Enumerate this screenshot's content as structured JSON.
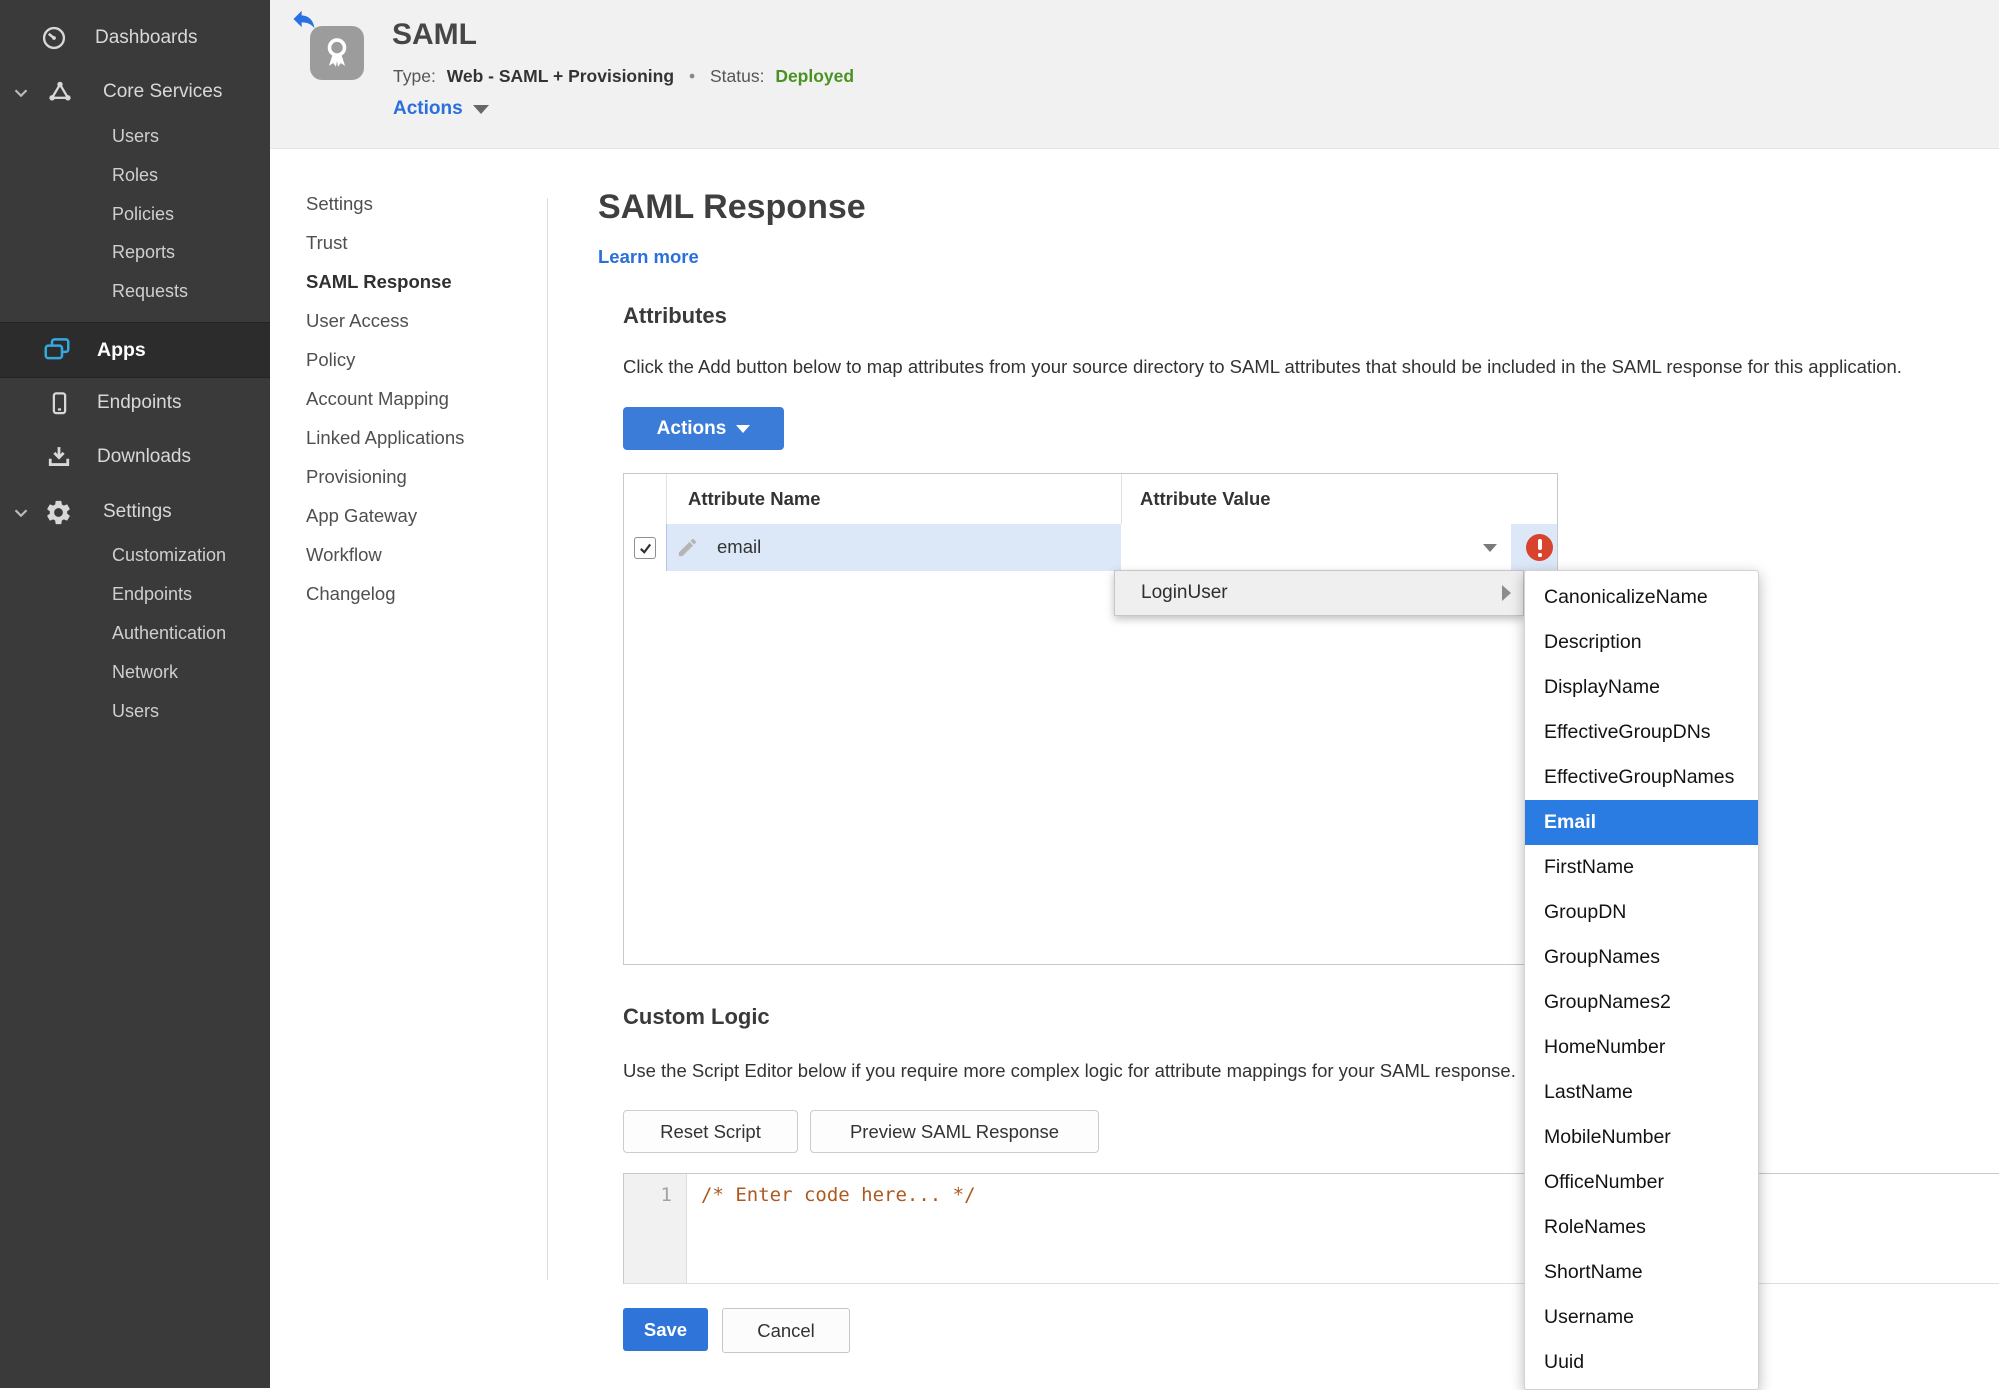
{
  "sidebar": {
    "dashboards_label": "Dashboards",
    "core_services_label": "Core Services",
    "core_items": [
      "Users",
      "Roles",
      "Policies",
      "Reports",
      "Requests"
    ],
    "apps_label": "Apps",
    "endpoints_label": "Endpoints",
    "downloads_label": "Downloads",
    "settings_label": "Settings",
    "settings_items": [
      "Customization",
      "Endpoints",
      "Authentication",
      "Network",
      "Users"
    ]
  },
  "header": {
    "title": "SAML",
    "type_label": "Type:",
    "type_value": "Web - SAML + Provisioning",
    "separator": "•",
    "status_label": "Status:",
    "status_value": "Deployed",
    "actions_label": "Actions"
  },
  "subnav": {
    "items": [
      "Settings",
      "Trust",
      "SAML Response",
      "User Access",
      "Policy",
      "Account Mapping",
      "Linked Applications",
      "Provisioning",
      "App Gateway",
      "Workflow",
      "Changelog"
    ],
    "active": "SAML Response"
  },
  "main": {
    "title": "SAML Response",
    "learn_more": "Learn more",
    "attributes_title": "Attributes",
    "attributes_desc": "Click the Add button below to map attributes from your source directory to SAML attributes that should be included in the SAML response for this application.",
    "actions_button": "Actions"
  },
  "attr_table": {
    "col_name": "Attribute Name",
    "col_value": "Attribute Value",
    "row": {
      "name": "email",
      "value": "",
      "checked": true,
      "error": true
    }
  },
  "value_menu": {
    "label": "LoginUser"
  },
  "value_submenu": {
    "items": [
      "CanonicalizeName",
      "Description",
      "DisplayName",
      "EffectiveGroupDNs",
      "EffectiveGroupNames",
      "Email",
      "FirstName",
      "GroupDN",
      "GroupNames",
      "GroupNames2",
      "HomeNumber",
      "LastName",
      "MobileNumber",
      "OfficeNumber",
      "RoleNames",
      "ShortName",
      "Username",
      "Uuid"
    ],
    "selected": "Email"
  },
  "custom_logic": {
    "title": "Custom Logic",
    "desc": "Use the Script Editor below if you require more complex logic for attribute mappings for your SAML response.",
    "reset_button": "Reset Script",
    "preview_button": "Preview SAML Response"
  },
  "editor": {
    "line_number": "1",
    "code": "/* Enter code here... */"
  },
  "footer": {
    "save": "Save",
    "cancel": "Cancel"
  },
  "colors": {
    "accent_blue": "#2b6fdd",
    "button_blue": "#3b7cd9",
    "selection_blue": "#2b7ce2",
    "status_green": "#4a9322",
    "error_red": "#d8432e",
    "sidebar_bg": "#3a3a3a",
    "row_highlight": "#dce8f8",
    "apps_icon_blue": "#32aae1",
    "code_comment": "#ac5a21"
  }
}
